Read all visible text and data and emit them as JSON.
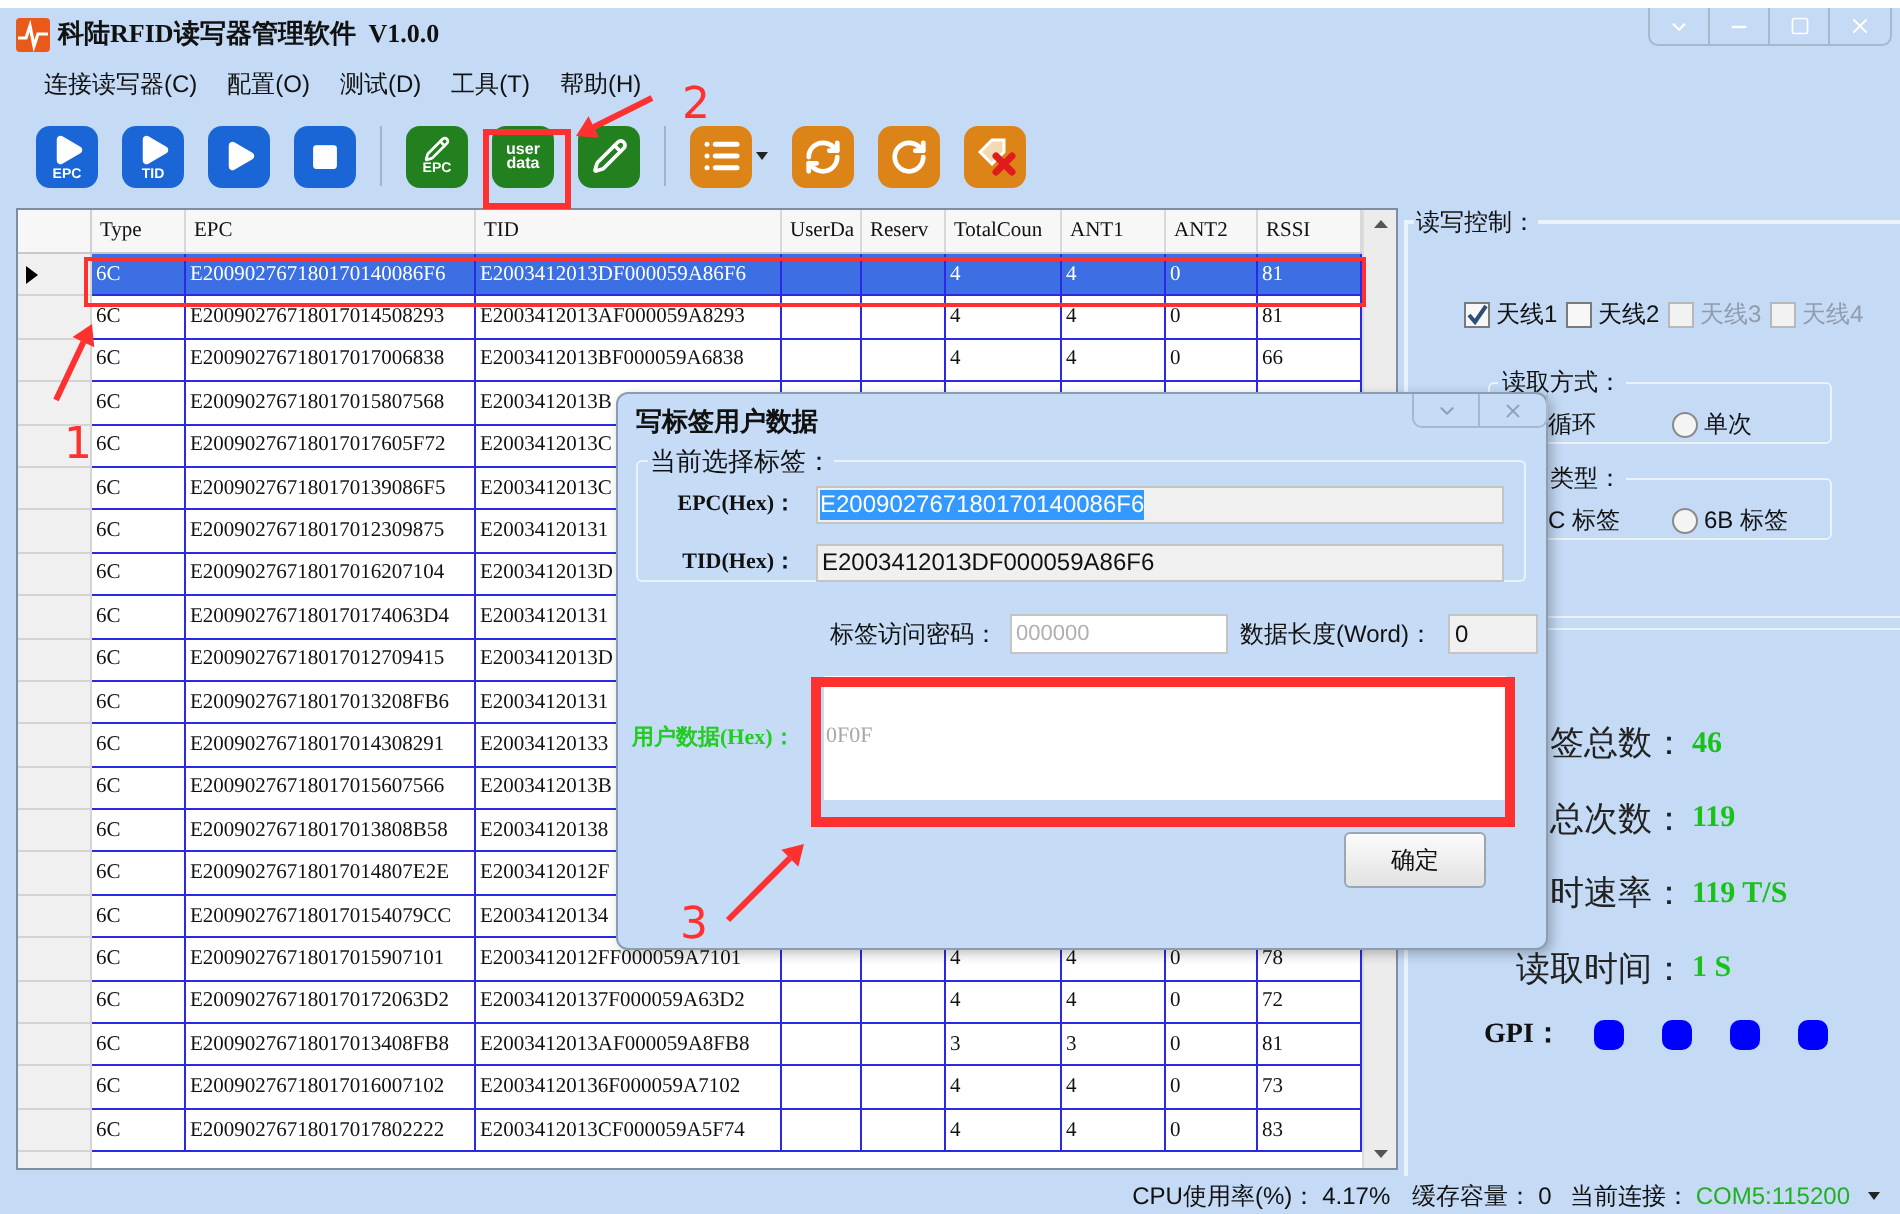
{
  "window": {
    "title": "科陆RFID读写器管理软件  V1.0.0"
  },
  "menu": [
    {
      "label": "连接读写器(C)"
    },
    {
      "label": "配置(O)"
    },
    {
      "label": "测试(D)"
    },
    {
      "label": "工具(T)"
    },
    {
      "label": "帮助(H)"
    }
  ],
  "toolbar": [
    {
      "kind": "button",
      "color": "#1a66d6",
      "label": "EPC"
    },
    {
      "kind": "button",
      "color": "#1a66d6",
      "label": "TID"
    },
    {
      "kind": "button",
      "color": "#1a66d6"
    },
    {
      "kind": "button",
      "color": "#1a66d6"
    },
    {
      "kind": "separator"
    },
    {
      "kind": "button",
      "color": "#23801f",
      "label": "EPC"
    },
    {
      "kind": "button",
      "color": "#23801f",
      "label": "user data"
    },
    {
      "kind": "button",
      "color": "#23801f"
    },
    {
      "kind": "separator"
    },
    {
      "kind": "menu-button",
      "color": "#dd8419"
    },
    {
      "kind": "button",
      "color": "#dd8419"
    },
    {
      "kind": "button",
      "color": "#dd8419"
    },
    {
      "kind": "button",
      "color": "#dd8419"
    }
  ],
  "table": {
    "columns": [
      "Type",
      "EPC",
      "TID",
      "UserDa",
      "Reserv",
      "TotalCoun",
      "ANT1",
      "ANT2",
      "RSSI"
    ],
    "rows": [
      {
        "selected": true,
        "type": "6C",
        "epc": "E200902767180170140086F6",
        "tid": "E2003412013DF000059A86F6",
        "total": "4",
        "ant1": "4",
        "ant2": "0",
        "rssi": "81"
      },
      {
        "selected": false,
        "type": "6C",
        "epc": "E20090276718017014508293",
        "tid": "E2003412013AF000059A8293",
        "total": "4",
        "ant1": "4",
        "ant2": "0",
        "rssi": "81"
      },
      {
        "selected": false,
        "type": "6C",
        "epc": "E20090276718017017006838",
        "tid": "E2003412013BF000059A6838",
        "total": "4",
        "ant1": "4",
        "ant2": "0",
        "rssi": "66"
      },
      {
        "selected": false,
        "type": "6C",
        "epc": "E20090276718017015807568",
        "tid": "E2003412013B"
      },
      {
        "selected": false,
        "type": "6C",
        "epc": "E20090276718017017605F72",
        "tid": "E2003412013C"
      },
      {
        "selected": false,
        "type": "6C",
        "epc": "E200902767180170139086F5",
        "tid": "E2003412013C"
      },
      {
        "selected": false,
        "type": "6C",
        "epc": "E20090276718017012309875",
        "tid": "E20034120131"
      },
      {
        "selected": false,
        "type": "6C",
        "epc": "E20090276718017016207104",
        "tid": "E2003412013D"
      },
      {
        "selected": false,
        "type": "6C",
        "epc": "E200902767180170174063D4",
        "tid": "E20034120131"
      },
      {
        "selected": false,
        "type": "6C",
        "epc": "E20090276718017012709415",
        "tid": "E2003412013D"
      },
      {
        "selected": false,
        "type": "6C",
        "epc": "E20090276718017013208FB6",
        "tid": "E20034120131"
      },
      {
        "selected": false,
        "type": "6C",
        "epc": "E20090276718017014308291",
        "tid": "E20034120133"
      },
      {
        "selected": false,
        "type": "6C",
        "epc": "E20090276718017015607566",
        "tid": "E2003412013B"
      },
      {
        "selected": false,
        "type": "6C",
        "epc": "E20090276718017013808B58",
        "tid": "E20034120138"
      },
      {
        "selected": false,
        "type": "6C",
        "epc": "E20090276718017014807E2E",
        "tid": "E2003412012F"
      },
      {
        "selected": false,
        "type": "6C",
        "epc": "E200902767180170154079CC",
        "tid": "E20034120134"
      },
      {
        "selected": false,
        "type": "6C",
        "epc": "E20090276718017015907101",
        "tid": "E2003412012FF000059A7101",
        "total": "4",
        "ant1": "4",
        "ant2": "0",
        "rssi": "78"
      },
      {
        "selected": false,
        "type": "6C",
        "epc": "E200902767180170172063D2",
        "tid": "E20034120137F000059A63D2",
        "total": "4",
        "ant1": "4",
        "ant2": "0",
        "rssi": "72"
      },
      {
        "selected": false,
        "type": "6C",
        "epc": "E20090276718017013408FB8",
        "tid": "E2003412013AF000059A8FB8",
        "total": "3",
        "ant1": "3",
        "ant2": "0",
        "rssi": "81"
      },
      {
        "selected": false,
        "type": "6C",
        "epc": "E20090276718017016007102",
        "tid": "E20034120136F000059A7102",
        "total": "4",
        "ant1": "4",
        "ant2": "0",
        "rssi": "73"
      },
      {
        "selected": false,
        "type": "6C",
        "epc": "E20090276718017017802222",
        "tid": "E2003412013CF000059A5F74",
        "total": "4",
        "ant1": "4",
        "ant2": "0",
        "rssi": "83"
      }
    ]
  },
  "read_control": {
    "title": "读写控制：",
    "antennas": [
      {
        "label": "天线1",
        "checked": true,
        "disabled": false
      },
      {
        "label": "天线2",
        "checked": false,
        "disabled": false
      },
      {
        "label": "天线3",
        "checked": false,
        "disabled": true
      },
      {
        "label": "天线4",
        "checked": false,
        "disabled": true
      }
    ],
    "read_mode": {
      "title": "读取方式：",
      "options": [
        {
          "kind": "text",
          "label": "循环"
        },
        {
          "kind": "radio",
          "label": "单次",
          "selected": false
        }
      ]
    },
    "tag_type": {
      "title": "类型：",
      "options": [
        {
          "kind": "text",
          "label": "C 标签"
        },
        {
          "kind": "radio",
          "label": "6B 标签",
          "selected": false
        }
      ]
    }
  },
  "stats": [
    {
      "label": "签总数：",
      "value": "46"
    },
    {
      "label": "总次数：",
      "value": "119"
    },
    {
      "label": "时速率：",
      "value": "119 T/S"
    },
    {
      "label": "读取时间：",
      "value": "1 S"
    }
  ],
  "gpi": {
    "label": "GPI：",
    "inputs": [
      {
        "on": true
      },
      {
        "on": true
      },
      {
        "on": true
      },
      {
        "on": true
      }
    ]
  },
  "dialog": {
    "title": "写标签用户数据",
    "group_title": "当前选择标签：",
    "epc": {
      "label": "EPC(Hex)：",
      "value": "E200902767180170140086F6"
    },
    "tid": {
      "label": "TID(Hex)：",
      "value": "E2003412013DF000059A86F6"
    },
    "password": {
      "label": "标签访问密码：",
      "placeholder": "000000"
    },
    "length": {
      "label": "数据长度(Word)：",
      "value": "0"
    },
    "user_data": {
      "label": "用户数据(Hex)：",
      "placeholder": "0F0F"
    },
    "ok_button": "确定"
  },
  "status_bar": {
    "cpu_label": "CPU使用率(%)：",
    "cpu_value": "4.17%",
    "cache_label": "缓存容量：",
    "cache_value": "0",
    "connection_label": "当前连接：",
    "connection_value": "COM5:115200"
  },
  "annotations": [
    {
      "label": "1"
    },
    {
      "label": "2"
    },
    {
      "label": "3"
    }
  ]
}
